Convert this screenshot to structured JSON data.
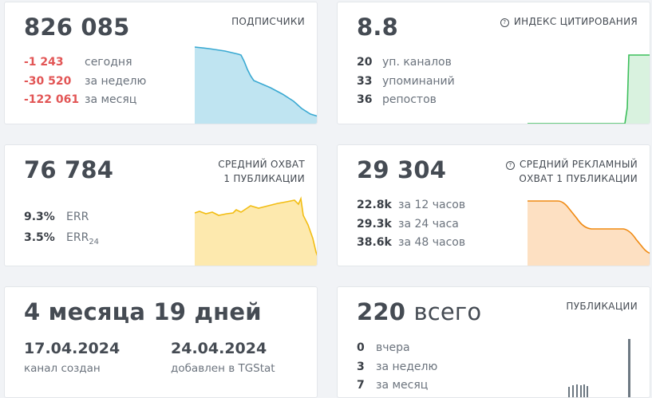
{
  "subscribers": {
    "value": "826 085",
    "label": "ПОДПИСЧИКИ",
    "rows": [
      {
        "value": "-1 243",
        "desc": "сегодня"
      },
      {
        "value": "-30 520",
        "desc": "за неделю"
      },
      {
        "value": "-122 061",
        "desc": "за месяц"
      }
    ],
    "chart": {
      "line": "#3aa9d2",
      "fill": "#bfe4f1",
      "levels": [
        0.96,
        0.94,
        0.92,
        0.9,
        0.88,
        0.85,
        0.72,
        0.55,
        0.5,
        0.45,
        0.38,
        0.28,
        0.18,
        0.1,
        0.05
      ]
    }
  },
  "citation": {
    "value": "8.8",
    "label": "ИНДЕКС ЦИТИРОВАНИЯ",
    "rows": [
      {
        "value": "20",
        "desc": "уп. каналов"
      },
      {
        "value": "33",
        "desc": "упоминаний"
      },
      {
        "value": "36",
        "desc": "репостов"
      }
    ],
    "chart": {
      "line": "#3cbf5b",
      "fill": "#d9f2df"
    }
  },
  "reach": {
    "value": "76 784",
    "label_lines": [
      "СРЕДНИЙ ОХВАТ",
      "1 ПУБЛИКАЦИИ"
    ],
    "rows": [
      {
        "value": "9.3%",
        "desc": "ERR"
      },
      {
        "value": "3.5%",
        "desc": "ERR",
        "sub": "24"
      }
    ],
    "chart": {
      "line": "#f2bd12",
      "fill": "#fde9ae"
    }
  },
  "ad_reach": {
    "value": "29 304",
    "label_lines": [
      "СРЕДНИЙ РЕКЛАМНЫЙ",
      "ОХВАТ 1 ПУБЛИКАЦИИ"
    ],
    "rows": [
      {
        "value": "22.8k",
        "desc": "за 12 часов"
      },
      {
        "value": "29.3k",
        "desc": "за 24 часа"
      },
      {
        "value": "38.6k",
        "desc": "за 48 часов"
      }
    ],
    "chart": {
      "line": "#f08a12",
      "fill": "#fde0c2"
    }
  },
  "age": {
    "value": "4 месяца 19 дней",
    "created_date": "17.04.2024",
    "created_label": "канал создан",
    "added_date": "24.04.2024",
    "added_label": "добавлен в TGStat"
  },
  "posts": {
    "value": "220",
    "value_suffix": "всего",
    "label": "ПУБЛИКАЦИИ",
    "rows": [
      {
        "value": "0",
        "desc": "вчера"
      },
      {
        "value": "3",
        "desc": "за неделю"
      },
      {
        "value": "7",
        "desc": "за месяц"
      }
    ],
    "chart": {
      "bar": "#6d7882"
    }
  }
}
